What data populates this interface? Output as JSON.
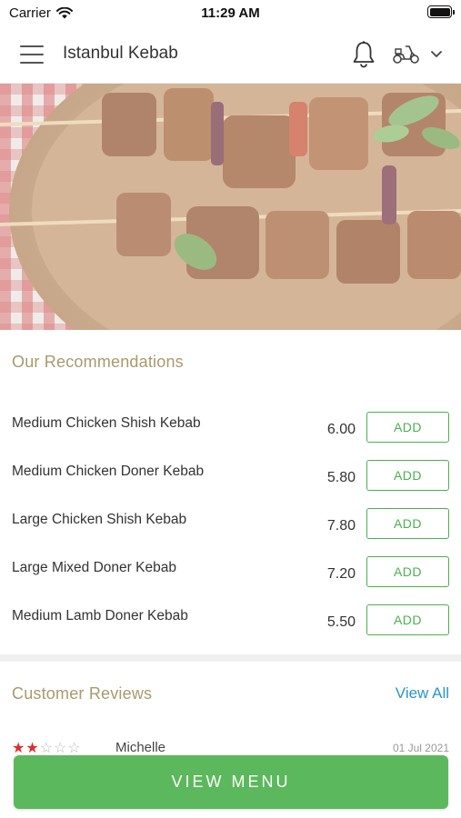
{
  "status_bar": {
    "carrier": "Carrier",
    "time": "11:29 AM"
  },
  "header": {
    "title": "Istanbul Kebab",
    "icons": [
      "menu-icon",
      "bell-icon",
      "scooter-icon",
      "chevron-down-icon"
    ]
  },
  "recommendations": {
    "title": "Our Recommendations",
    "add_label": "ADD",
    "items": [
      {
        "name": "Medium Chicken Shish Kebab",
        "price": "6.00"
      },
      {
        "name": "Medium Chicken Doner Kebab",
        "price": "5.80"
      },
      {
        "name": "Large Chicken Shish Kebab",
        "price": "7.80"
      },
      {
        "name": "Large Mixed Doner Kebab",
        "price": "7.20"
      },
      {
        "name": "Medium Lamb Doner Kebab",
        "price": "5.50"
      }
    ]
  },
  "reviews": {
    "title": "Customer Reviews",
    "view_all": "View All",
    "first": {
      "reviewer": "Michelle",
      "date": "01 Jul 2021",
      "rating": 2,
      "max_rating": 5
    }
  },
  "footer": {
    "view_menu_label": "VIEW MENU"
  },
  "colors": {
    "accent_green": "#5cb85c",
    "section_title": "#a89a6c",
    "link_blue": "#2a96c7",
    "star_red": "#d9302c"
  }
}
